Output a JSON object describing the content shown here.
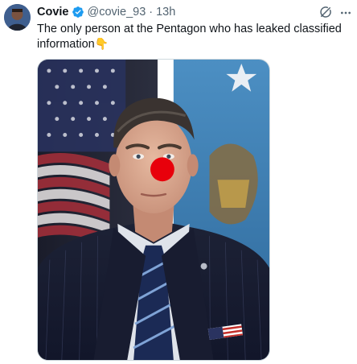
{
  "tweet": {
    "author": {
      "display_name": "Covie",
      "verified": true,
      "handle": "@covie_93"
    },
    "separator": "·",
    "time": "13h",
    "text": "The only person at the Pentagon who has leaked classified information",
    "emoji": "👇"
  },
  "icons": {
    "avatar": "avatar-icon",
    "verified": "verified-badge-icon",
    "grok": "grok-icon",
    "more": "more-icon"
  },
  "colors": {
    "verified_blue": "#1d9bf0",
    "text_primary": "#0f1419",
    "text_secondary": "#536471",
    "clown_nose": "#e8000b"
  },
  "media": {
    "type": "photo",
    "description_icon": "portrait-photo"
  }
}
